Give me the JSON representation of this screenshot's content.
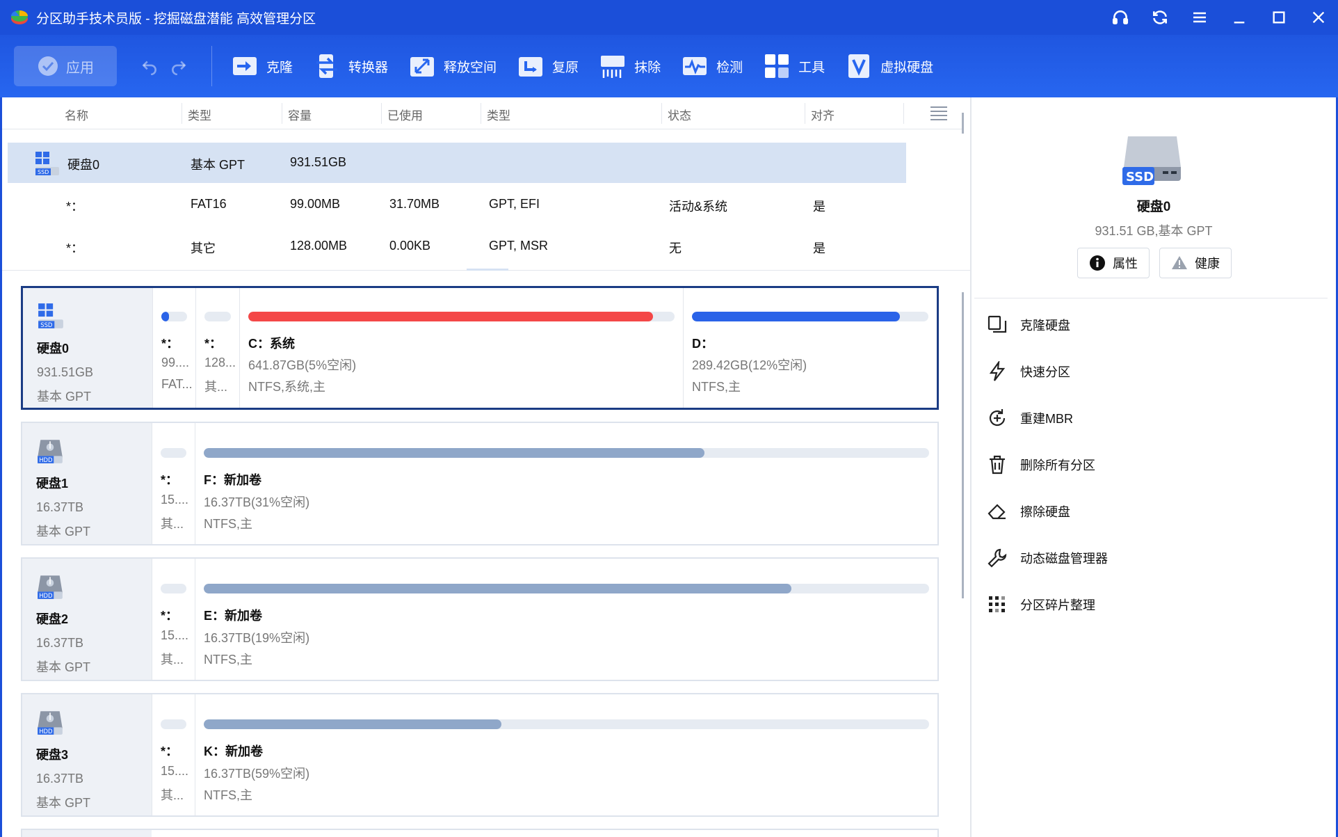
{
  "window": {
    "title": "分区助手技术员版 - 挖掘磁盘潜能 高效管理分区",
    "brand_color": "#1b4fd9"
  },
  "toolbar": {
    "apply_label": "应用",
    "tools": [
      {
        "label": "克隆",
        "icon": "clone-icon"
      },
      {
        "label": "转换器",
        "icon": "convert-icon"
      },
      {
        "label": "释放空间",
        "icon": "free-space-icon"
      },
      {
        "label": "复原",
        "icon": "recover-icon"
      },
      {
        "label": "抹除",
        "icon": "wipe-icon"
      },
      {
        "label": "检测",
        "icon": "detect-icon"
      },
      {
        "label": "工具",
        "icon": "tools-icon"
      },
      {
        "label": "虚拟硬盘",
        "icon": "virtual-disk-icon"
      }
    ]
  },
  "list": {
    "headers": [
      "名称",
      "类型",
      "容量",
      "已使用",
      "类型",
      "状态",
      "对齐"
    ],
    "rows": [
      {
        "name": "硬盘0",
        "type": "基本 GPT",
        "capacity": "931.51GB",
        "used": "",
        "ptype": "",
        "status": "",
        "align": ""
      },
      {
        "name": "*：",
        "type": "FAT16",
        "capacity": "99.00MB",
        "used": "31.70MB",
        "ptype": "GPT, EFI",
        "status": "活动&系统",
        "align": "是"
      },
      {
        "name": "*：",
        "type": "其它",
        "capacity": "128.00MB",
        "used": "0.00KB",
        "ptype": "GPT, MSR",
        "status": "无",
        "align": "是"
      }
    ]
  },
  "disks": [
    {
      "name": "硬盘0",
      "size": "931.51GB",
      "type": "基本 GPT",
      "kind": "SSD",
      "partitions": [
        {
          "label": "*：",
          "size": "99....",
          "fs": "FAT...",
          "used_fraction": 0.3,
          "color": "#2a63e8"
        },
        {
          "label": "*：",
          "size": "128...",
          "fs": "其...",
          "used_fraction": 0.0,
          "color": "#2a63e8"
        },
        {
          "label": "C：系统",
          "size": "641.87GB(5%空闲)",
          "fs": "NTFS,系统,主",
          "used_fraction": 0.95,
          "color": "#f44747"
        },
        {
          "label": "D：",
          "size": "289.42GB(12%空闲)",
          "fs": "NTFS,主",
          "used_fraction": 0.88,
          "color": "#2a63e8"
        }
      ]
    },
    {
      "name": "硬盘1",
      "size": "16.37TB",
      "type": "基本 GPT",
      "kind": "HDD",
      "partitions": [
        {
          "label": "*：",
          "size": "15....",
          "fs": "其...",
          "used_fraction": 0.0,
          "color": "#8fa7c9"
        },
        {
          "label": "F：新加卷",
          "size": "16.37TB(31%空闲)",
          "fs": "NTFS,主",
          "used_fraction": 0.69,
          "color": "#8fa7c9"
        }
      ]
    },
    {
      "name": "硬盘2",
      "size": "16.37TB",
      "type": "基本 GPT",
      "kind": "HDD",
      "partitions": [
        {
          "label": "*：",
          "size": "15....",
          "fs": "其...",
          "used_fraction": 0.0,
          "color": "#8fa7c9"
        },
        {
          "label": "E：新加卷",
          "size": "16.37TB(19%空闲)",
          "fs": "NTFS,主",
          "used_fraction": 0.81,
          "color": "#8fa7c9"
        }
      ]
    },
    {
      "name": "硬盘3",
      "size": "16.37TB",
      "type": "基本 GPT",
      "kind": "HDD",
      "partitions": [
        {
          "label": "*：",
          "size": "15....",
          "fs": "其...",
          "used_fraction": 0.0,
          "color": "#8fa7c9"
        },
        {
          "label": "K：新加卷",
          "size": "16.37TB(59%空闲)",
          "fs": "NTFS,主",
          "used_fraction": 0.41,
          "color": "#8fa7c9"
        }
      ]
    }
  ],
  "right_panel": {
    "disk_name": "硬盘0",
    "disk_info": "931.51 GB,基本 GPT",
    "ssd_badge": "SSD",
    "properties_label": "属性",
    "health_label": "健康",
    "actions": [
      {
        "label": "克隆硬盘",
        "icon": "clone-disk-icon"
      },
      {
        "label": "快速分区",
        "icon": "quick-partition-icon"
      },
      {
        "label": "重建MBR",
        "icon": "rebuild-mbr-icon"
      },
      {
        "label": "删除所有分区",
        "icon": "delete-all-icon"
      },
      {
        "label": "擦除硬盘",
        "icon": "eraser-icon"
      },
      {
        "label": "动态磁盘管理器",
        "icon": "wrench-icon"
      },
      {
        "label": "分区碎片整理",
        "icon": "defrag-icon"
      }
    ]
  }
}
